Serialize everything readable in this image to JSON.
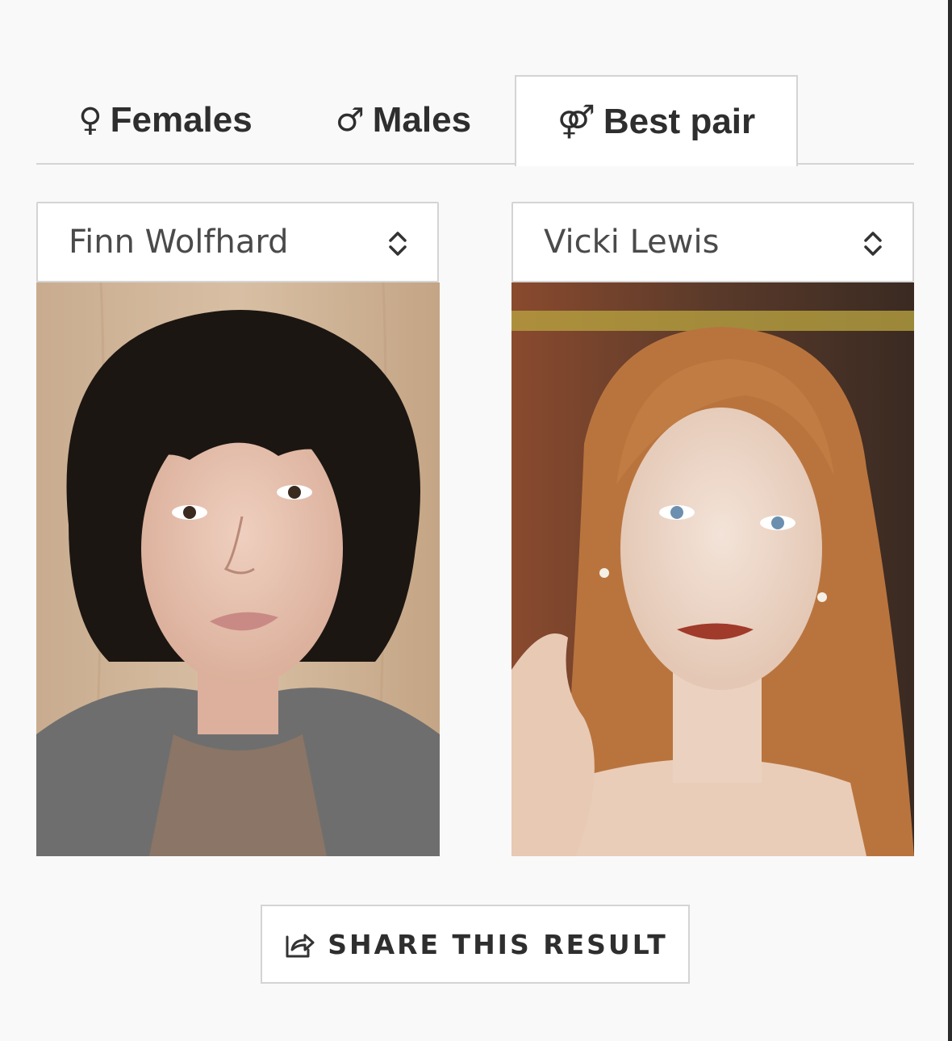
{
  "tabs": [
    {
      "symbol": "♀",
      "label": "Females",
      "active": false
    },
    {
      "symbol": "♂",
      "label": "Males",
      "active": false
    },
    {
      "symbol": "⚤",
      "label": "Best pair",
      "active": true
    }
  ],
  "left_person": {
    "name": "Finn Wolfhard"
  },
  "right_person": {
    "name": "Vicki Lewis"
  },
  "share": {
    "label": "SHARE THIS RESULT",
    "icon": "share-icon"
  },
  "colors": {
    "background": "#f9f9f9",
    "border": "#d4d4d4",
    "text": "#2e2e2e"
  }
}
